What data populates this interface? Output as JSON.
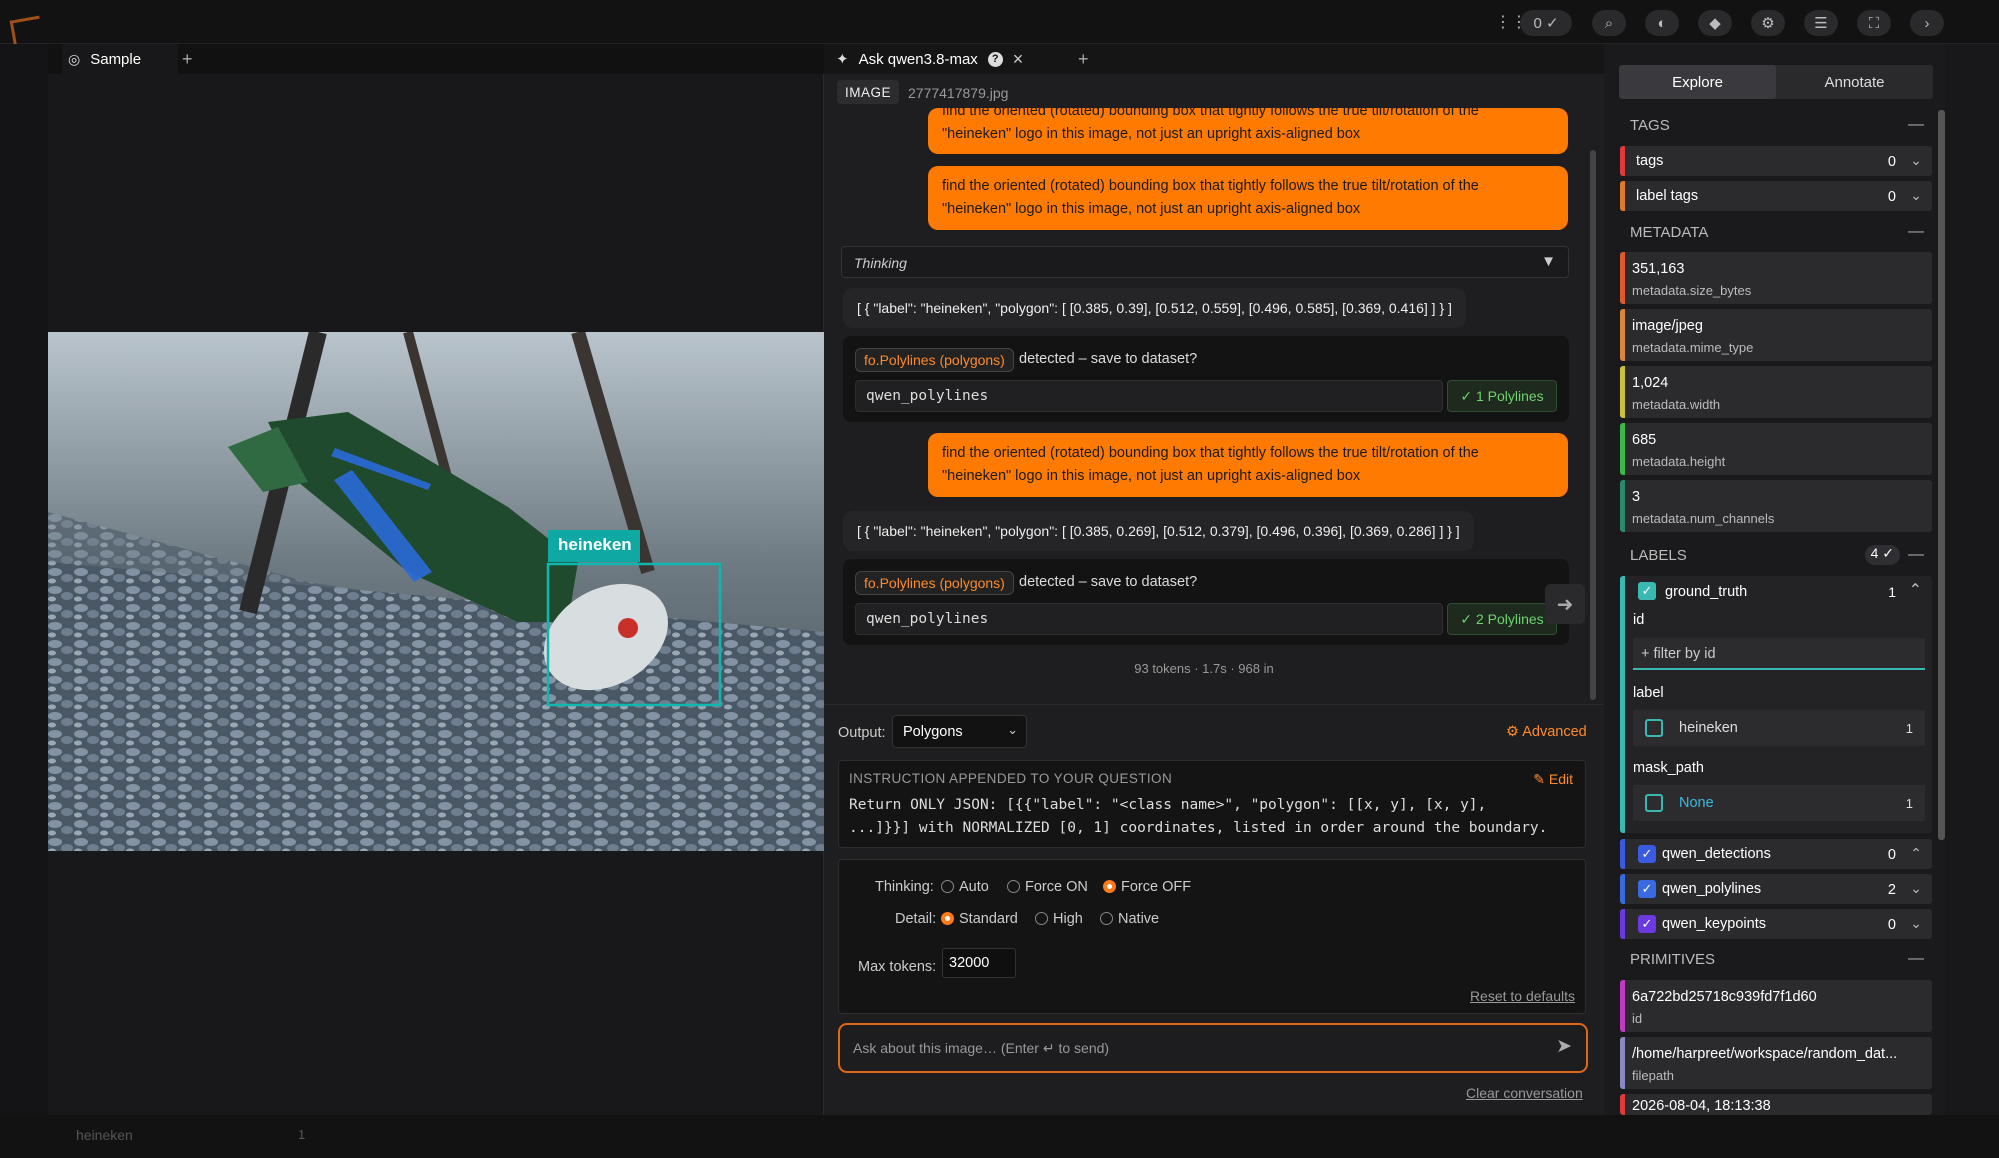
{
  "sample_tabs": {
    "sample_label": "Sample",
    "add": "+"
  },
  "chat_tabs": {
    "title": "Ask qwen3.8-max",
    "help": "?",
    "close": "×",
    "add": "+"
  },
  "image_badge": "IMAGE",
  "image_filename": "2777417879.jpg",
  "bbox_label": "heineken",
  "messages": {
    "user_text_line1": "find the oriented (rotated) bounding box that tightly follows the true tilt/rotation of the",
    "user_text_line2": "\"heineken\" logo in this image, not just an upright axis-aligned box",
    "thinking_label": "Thinking",
    "json1": "[ { \"label\": \"heineken\", \"polygon\": [ [0.385, 0.39], [0.512, 0.559], [0.496, 0.585], [0.369, 0.416] ] } ]",
    "json2": "[ { \"label\": \"heineken\", \"polygon\": [ [0.385, 0.269], [0.512, 0.379], [0.496, 0.396], [0.369, 0.286] ] } ]",
    "detect_chip": "fo.Polylines (polygons)",
    "detect_text": "detected – save to dataset?",
    "field_value": "qwen_polylines",
    "btn1": "✓ 1 Polylines",
    "btn2": "✓ 2 Polylines",
    "stats": "93 tokens · 1.7s · 968 in"
  },
  "controls": {
    "output_label": "Output:",
    "output_value": "Polygons",
    "advanced": "Advanced",
    "instruction_header": "INSTRUCTION APPENDED TO YOUR QUESTION",
    "edit": "Edit",
    "instruction_line1": "Return ONLY JSON: [{{\"label\": \"<class name>\", \"polygon\": [[x, y], [x, y],",
    "instruction_line2": "...]}}] with NORMALIZED [0, 1] coordinates, listed in order around the boundary.",
    "thinking_label": "Thinking:",
    "thinking_options": [
      "Auto",
      "Force ON",
      "Force OFF"
    ],
    "detail_label": "Detail:",
    "detail_options": [
      "Standard",
      "High",
      "Native"
    ],
    "max_tokens_label": "Max tokens:",
    "max_tokens_value": "32000",
    "reset": "Reset to defaults",
    "input_placeholder": "Ask about this image… (Enter ↵ to send)",
    "clear": "Clear conversation"
  },
  "sidebar": {
    "tabs": [
      "Explore",
      "Annotate"
    ],
    "tags_header": "TAGS",
    "tags": [
      {
        "label": "tags",
        "count": "0"
      },
      {
        "label": "label tags",
        "count": "0"
      }
    ],
    "metadata_header": "METADATA",
    "metadata": [
      {
        "value": "351,163",
        "key": "metadata.size_bytes",
        "color": "#e0592a"
      },
      {
        "value": "image/jpeg",
        "key": "metadata.mime_type",
        "color": "#d9863a"
      },
      {
        "value": "1,024",
        "key": "metadata.width",
        "color": "#c9c23a"
      },
      {
        "value": "685",
        "key": "metadata.height",
        "color": "#3ab84a"
      },
      {
        "value": "3",
        "key": "metadata.num_channels",
        "color": "#2a8a6a"
      }
    ],
    "labels_header": "LABELS",
    "labels_count": "4",
    "ground_truth": {
      "label": "ground_truth",
      "count": "1",
      "id_label": "id",
      "filter_placeholder": "+ filter by id",
      "label_label": "label",
      "label_value": "heineken",
      "label_count": "1",
      "mask_label": "mask_path",
      "mask_value": "None",
      "mask_count": "1"
    },
    "label_fields": [
      {
        "label": "qwen_detections",
        "count": "0",
        "color": "#3a5ae0"
      },
      {
        "label": "qwen_polylines",
        "count": "2",
        "color": "#3a6ae0"
      },
      {
        "label": "qwen_keypoints",
        "count": "0",
        "color": "#6a3ae0"
      }
    ],
    "primitives_header": "PRIMITIVES",
    "primitives": [
      {
        "value": "6a722bd25718c939fd7f1d60",
        "key": "id",
        "color": "#c23ac2"
      },
      {
        "value": "/home/harpreet/workspace/random_dat...",
        "key": "filepath",
        "color": "#8a8ac2"
      },
      {
        "value": "2026-08-04, 18:13:38",
        "key": "",
        "color": "#e03a3a"
      }
    ]
  },
  "topbar": {
    "counter": "0",
    "bg_label": "heineken",
    "bg_count": "1"
  }
}
